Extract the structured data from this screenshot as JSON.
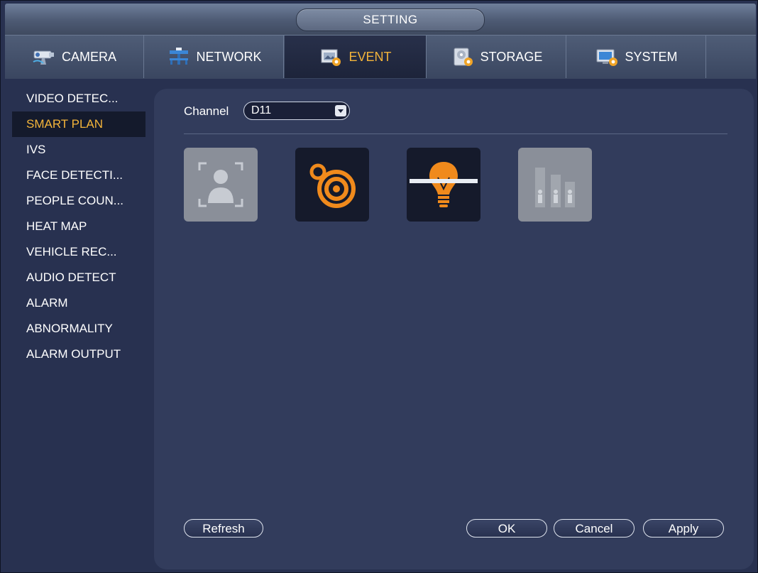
{
  "window": {
    "title": "SETTING"
  },
  "tabs": [
    {
      "label": "CAMERA",
      "icon": "camera-icon",
      "active": false
    },
    {
      "label": "NETWORK",
      "icon": "network-icon",
      "active": false
    },
    {
      "label": "EVENT",
      "icon": "event-icon",
      "active": true
    },
    {
      "label": "STORAGE",
      "icon": "storage-icon",
      "active": false
    },
    {
      "label": "SYSTEM",
      "icon": "system-icon",
      "active": false
    }
  ],
  "sidebar": {
    "items": [
      {
        "label": "VIDEO DETEC..."
      },
      {
        "label": "SMART PLAN",
        "active": true
      },
      {
        "label": "IVS"
      },
      {
        "label": "FACE DETECTI..."
      },
      {
        "label": "PEOPLE COUN..."
      },
      {
        "label": "HEAT MAP"
      },
      {
        "label": "VEHICLE REC..."
      },
      {
        "label": "AUDIO DETECT"
      },
      {
        "label": "ALARM"
      },
      {
        "label": "ABNORMALITY"
      },
      {
        "label": "ALARM OUTPUT"
      }
    ]
  },
  "main": {
    "channel_label": "Channel",
    "channel_value": "D11",
    "plans": [
      {
        "icon": "face-detection-icon",
        "enabled": false
      },
      {
        "icon": "ivs-icon",
        "enabled": true
      },
      {
        "icon": "tripwire-bulb-icon",
        "enabled": true
      },
      {
        "icon": "people-counting-icon",
        "enabled": false
      }
    ],
    "buttons": {
      "refresh": "Refresh",
      "ok": "OK",
      "cancel": "Cancel",
      "apply": "Apply"
    }
  },
  "colors": {
    "accent": "#f3b43a",
    "icon_orange": "#f08a1c",
    "panel_bg": "#323c5c",
    "window_bg": "#283150"
  }
}
